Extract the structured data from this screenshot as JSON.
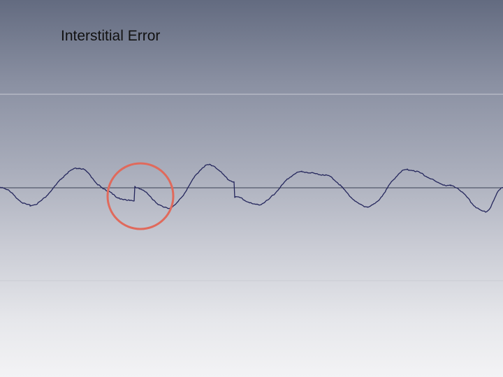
{
  "slide": {
    "title": "Interstitial Error"
  },
  "figure": {
    "waveform_color": "#24265c",
    "zero_line_color": "#3a3f55",
    "guide_line_color": "#c9cbd3",
    "highlight_color": "#e06a5c",
    "highlight_meaning": "discontinuity in the waveform"
  }
}
